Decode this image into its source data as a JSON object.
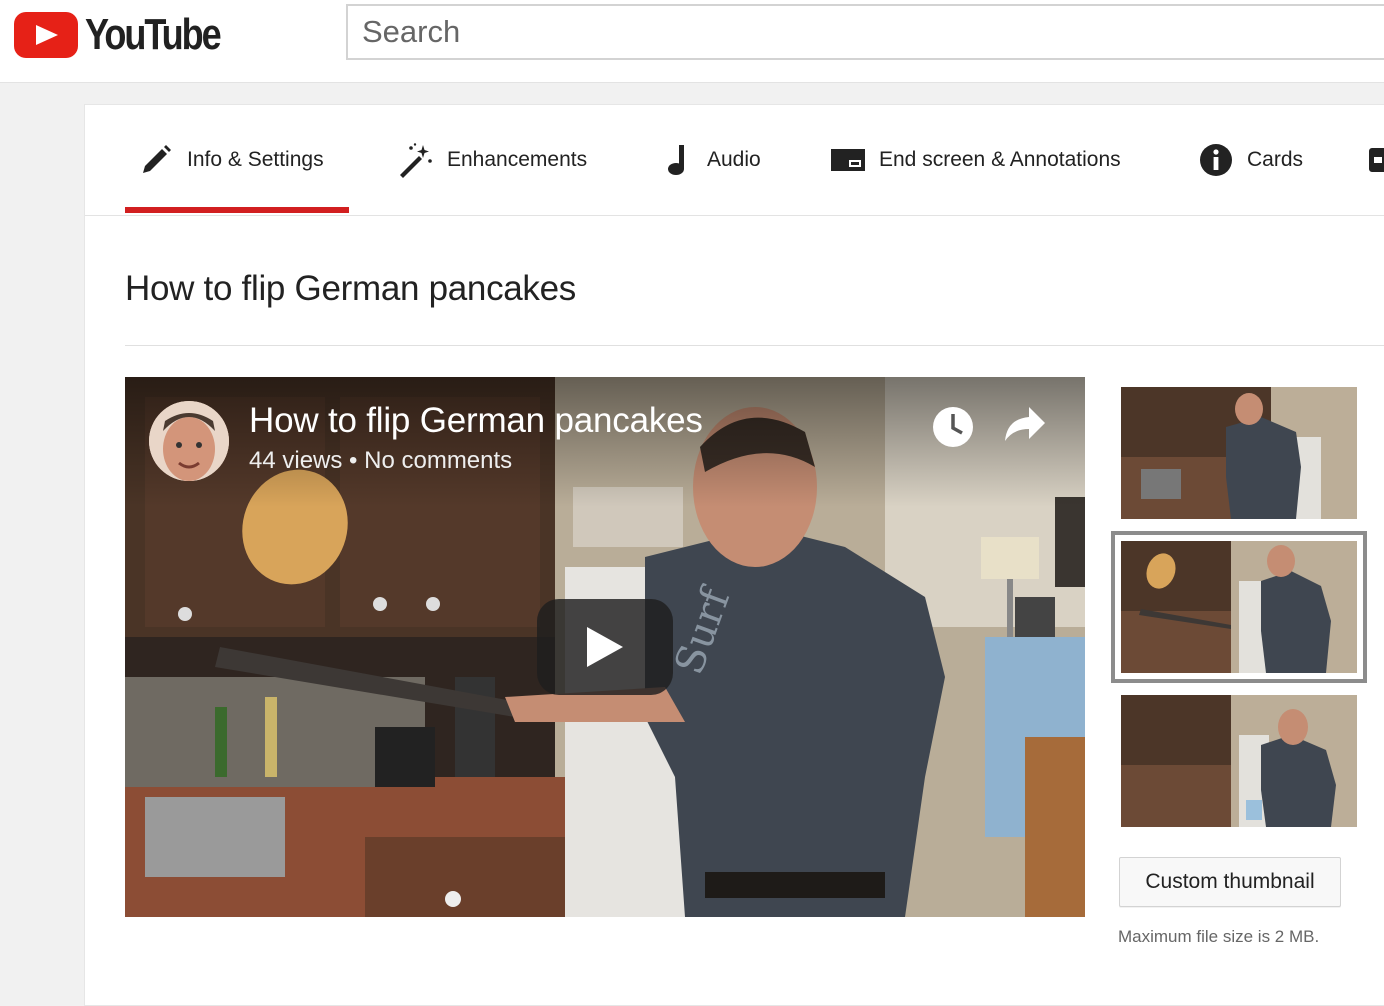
{
  "header": {
    "logo_text": "YouTube",
    "search_placeholder": "Search"
  },
  "tabs": [
    {
      "label": "Info & Settings",
      "icon": "pencil-icon",
      "active": true
    },
    {
      "label": "Enhancements",
      "icon": "magic-wand-icon"
    },
    {
      "label": "Audio",
      "icon": "music-note-icon"
    },
    {
      "label": "End screen & Annotations",
      "icon": "end-screen-icon"
    },
    {
      "label": "Cards",
      "icon": "info-icon"
    }
  ],
  "colors": {
    "brand_red": "#e62117",
    "active_tab_underline": "#d21f20"
  },
  "video": {
    "title": "How to flip German pancakes",
    "views": "44 views",
    "separator": "•",
    "comments": "No comments"
  },
  "player_controls": {
    "watch_later_icon": "clock-icon",
    "share_icon": "share-arrow-icon",
    "play_icon": "play-icon"
  },
  "thumbnails": {
    "options": [
      "thumbnail-1",
      "thumbnail-2",
      "thumbnail-3"
    ],
    "selected": "thumbnail-2",
    "custom_button_label": "Custom thumbnail",
    "note": "Maximum file size is 2 MB."
  }
}
